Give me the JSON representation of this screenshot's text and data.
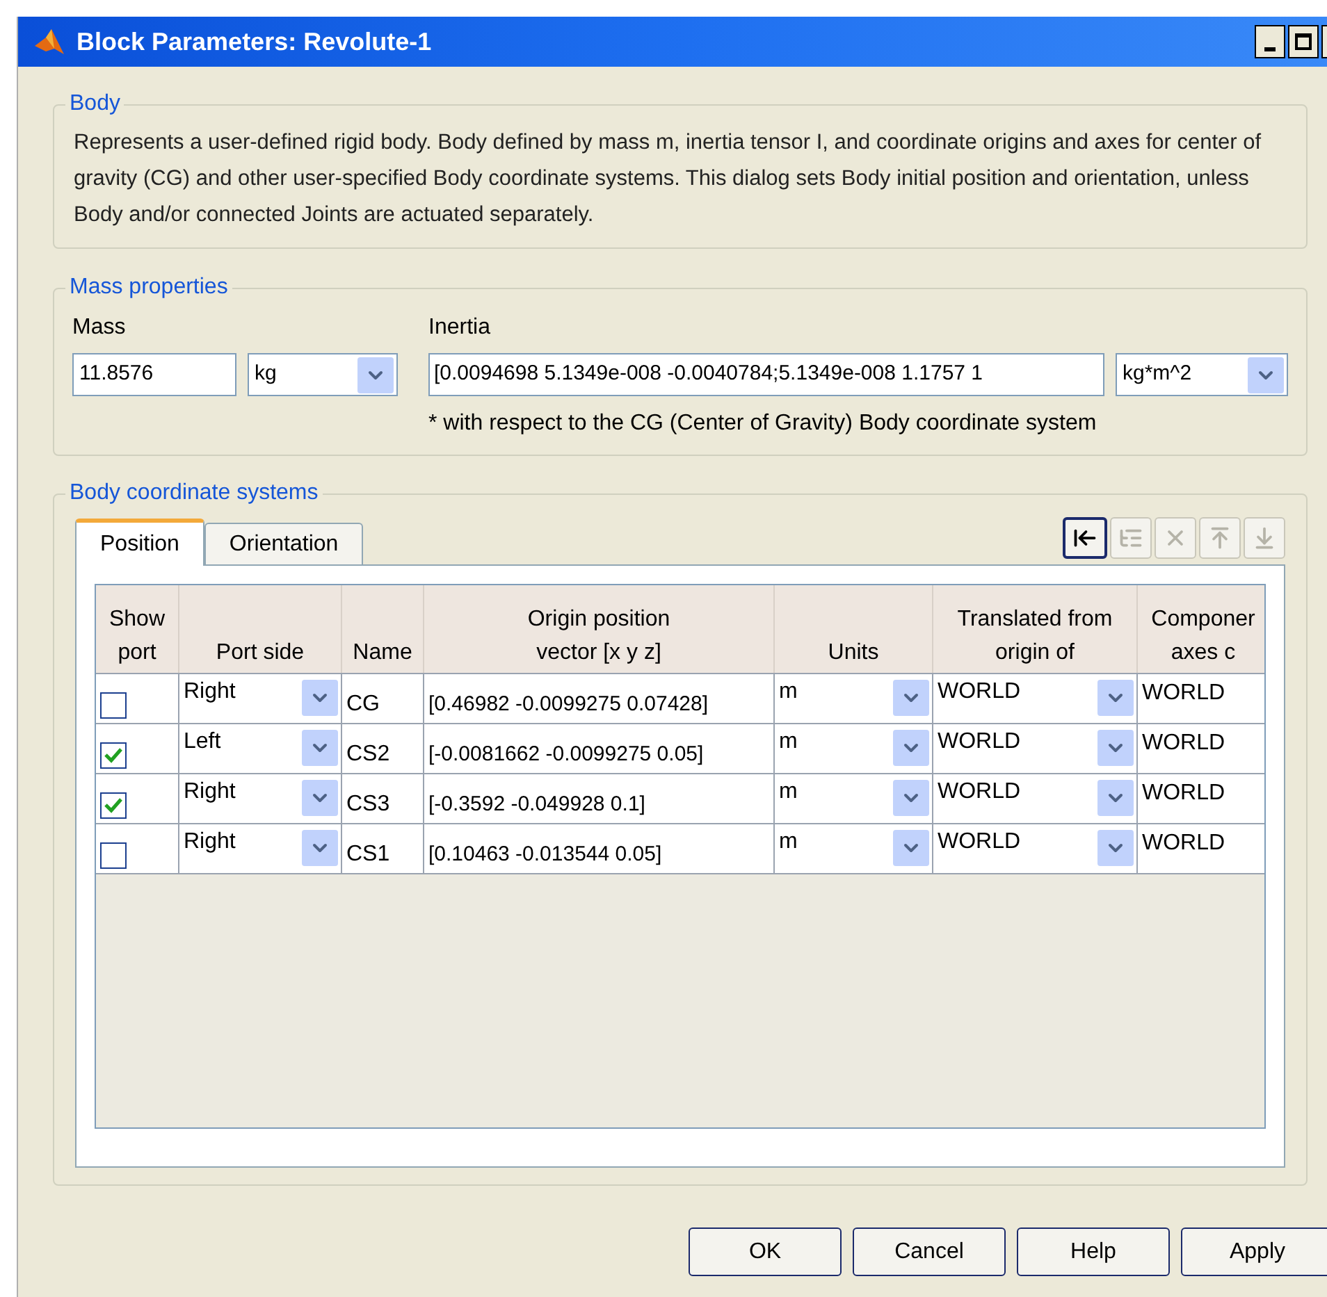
{
  "window": {
    "title": "Block Parameters: Revolute-1"
  },
  "body": {
    "legend": "Body",
    "description": "Represents a user-defined rigid body. Body defined by mass m, inertia tensor I, and coordinate origins and axes for center of gravity (CG) and other user-specified Body coordinate systems. This dialog sets Body initial position and orientation, unless Body and/or connected Joints are actuated separately."
  },
  "mass_properties": {
    "legend": "Mass properties",
    "mass_label": "Mass",
    "mass_value": "11.8576",
    "mass_units": "kg",
    "inertia_label": "Inertia",
    "inertia_value": "[0.0094698 5.1349e-008 -0.0040784;5.1349e-008 1.1757 1",
    "inertia_units": "kg*m^2",
    "note": "* with respect to the CG (Center of Gravity) Body coordinate system"
  },
  "coordinate_systems": {
    "legend": "Body coordinate systems",
    "tabs": [
      {
        "label": "Position",
        "selected": true
      },
      {
        "label": "Orientation",
        "selected": false
      }
    ],
    "toolbar": [
      {
        "kind": "add",
        "disabled": false
      },
      {
        "kind": "indent",
        "disabled": true
      },
      {
        "kind": "delete",
        "disabled": true
      },
      {
        "kind": "up",
        "disabled": true
      },
      {
        "kind": "down",
        "disabled": true
      }
    ],
    "table": {
      "columns": [
        [
          "Show",
          "port"
        ],
        [
          "Port side"
        ],
        [
          "Name"
        ],
        [
          "Origin position",
          "vector [x y z]"
        ],
        [
          "Units"
        ],
        [
          "Translated from",
          "origin of"
        ],
        [
          "Componer",
          "axes c"
        ]
      ],
      "rows": [
        {
          "show_port": false,
          "port_side": "Right",
          "name": "CG",
          "origin": "[0.46982 -0.0099275 0.07428]",
          "units": "m",
          "translated_from": "WORLD",
          "components": "WORLD"
        },
        {
          "show_port": true,
          "port_side": "Left",
          "name": "CS2",
          "origin": "[-0.0081662 -0.0099275 0.05]",
          "units": "m",
          "translated_from": "WORLD",
          "components": "WORLD"
        },
        {
          "show_port": true,
          "port_side": "Right",
          "name": "CS3",
          "origin": "[-0.3592 -0.049928 0.1]",
          "units": "m",
          "translated_from": "WORLD",
          "components": "WORLD"
        },
        {
          "show_port": false,
          "port_side": "Right",
          "name": "CS1",
          "origin": "[0.10463 -0.013544 0.05]",
          "units": "m",
          "translated_from": "WORLD",
          "components": "WORLD"
        }
      ]
    }
  },
  "buttons": [
    "OK",
    "Cancel",
    "Help",
    "Apply"
  ]
}
